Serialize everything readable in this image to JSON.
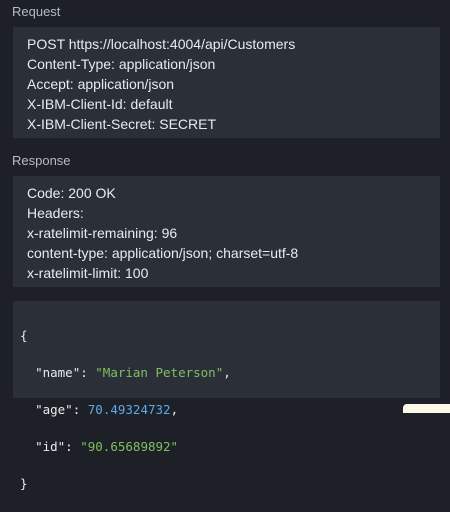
{
  "request": {
    "label": "Request",
    "lines": [
      "POST https://localhost:4004/api/Customers",
      "Content-Type: application/json",
      "Accept: application/json",
      "X-IBM-Client-Id: default",
      "X-IBM-Client-Secret: SECRET"
    ]
  },
  "response": {
    "label": "Response",
    "lines": [
      "Code: 200 OK",
      "Headers:",
      "x-ratelimit-remaining: 96",
      "content-type: application/json; charset=utf-8",
      "x-ratelimit-limit: 100"
    ]
  },
  "body": {
    "open_brace": "{",
    "close_brace": "}",
    "fields": [
      {
        "key": "\"name\"",
        "value": "\"Marian Peterson\"",
        "type": "string",
        "trail": ","
      },
      {
        "key": "\"age\"",
        "value": "70.49324732",
        "type": "number",
        "trail": ","
      },
      {
        "key": "\"id\"",
        "value": "\"90.65689892\"",
        "type": "string",
        "trail": ""
      }
    ]
  },
  "colors": {
    "background": "#1d2127",
    "panel": "#2b3038",
    "string": "#7fbf5f",
    "number": "#5fa8e8"
  }
}
